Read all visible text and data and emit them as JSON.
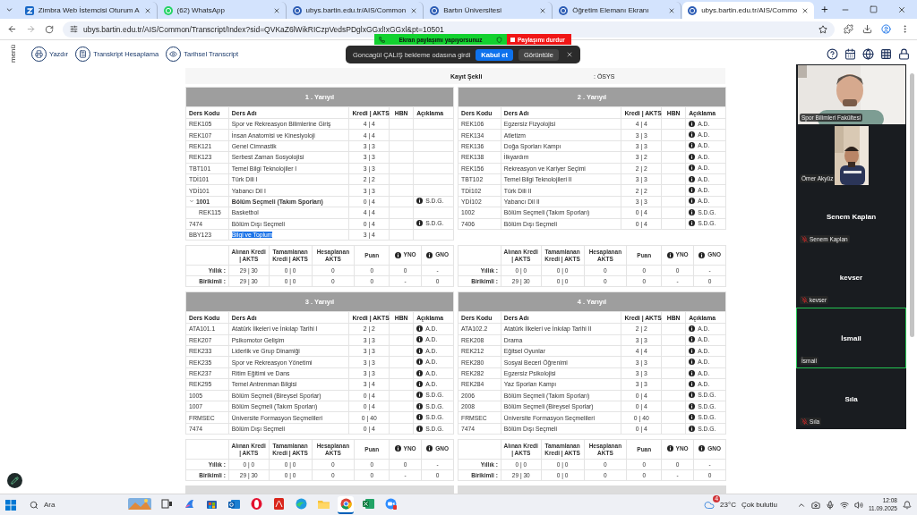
{
  "browser": {
    "tabs": [
      {
        "title": "Zimbra Web İstemcisi Oturum A",
        "kind": "zimbra",
        "selected": false
      },
      {
        "title": "(62) WhatsApp",
        "kind": "whatsapp",
        "selected": false
      },
      {
        "title": "ubys.bartin.edu.tr/AIS/Common",
        "kind": "site",
        "selected": false
      },
      {
        "title": "Bartın Üniversitesi",
        "kind": "site",
        "selected": false
      },
      {
        "title": "Öğretim Elemanı Ekranı",
        "kind": "site",
        "selected": false
      },
      {
        "title": "ubys.bartin.edu.tr/AIS/Commo",
        "kind": "site",
        "selected": true
      }
    ],
    "url": "ubys.bartin.edu.tr/AIS/Common/Transcript/Index?sid=QVKaZ6lWikRICzpVedsPDglxGGxl!xGGxl&pt=10501"
  },
  "toolbar": {
    "menu_label": "menü",
    "buttons": [
      {
        "kind": "print",
        "label": "Yazdır"
      },
      {
        "kind": "calculator",
        "label": "Transkript Hesaplama"
      },
      {
        "kind": "eye",
        "label": "Tarihsel Transcript"
      }
    ],
    "icons": [
      {
        "kind": "help"
      },
      {
        "kind": "calendar"
      },
      {
        "kind": "globe"
      },
      {
        "kind": "apps"
      },
      {
        "kind": "lock"
      }
    ]
  },
  "student_info": {
    "label": "Kayıt Şekli",
    "value": ": ÖSYS"
  },
  "semesters": [
    {
      "title": "1 . Yarıyıl",
      "columns": [
        "Ders Kodu",
        "Ders Adı",
        "Kredi | AKTS",
        "HBN",
        "Açıklama"
      ],
      "courses": [
        {
          "code": "REK105",
          "name": "Spor ve Rekreasyon Bilimlerine Giriş",
          "credits": "4 | 4"
        },
        {
          "code": "REK107",
          "name": "İnsan Anatomisi ve Kinesiyoloji",
          "credits": "4 | 4"
        },
        {
          "code": "REK121",
          "name": "Genel Cimnastik",
          "credits": "3 | 3"
        },
        {
          "code": "REK123",
          "name": "Serbest Zaman Sosyolojisi",
          "credits": "3 | 3"
        },
        {
          "code": "TBT101",
          "name": "Temel Bilgi Teknolojiler I",
          "credits": "3 | 3"
        },
        {
          "code": "TDİ101",
          "name": "Türk Dili I",
          "credits": "2 | 2"
        },
        {
          "code": "YDİ101",
          "name": "Yabancı Dil I",
          "credits": "3 | 3"
        },
        {
          "code": "1001",
          "name": "Bölüm Seçmeli (Takım Sporları)",
          "credits": "0 | 4",
          "note": "S.D.G.",
          "expanded": true,
          "children": [
            {
              "code": "REK115",
              "name": "Basketbol",
              "credits": "4 | 4"
            }
          ]
        },
        {
          "code": "7474",
          "name": "Bölüm Dışı Seçmeli",
          "credits": "0 | 4",
          "note": "S.D.G."
        },
        {
          "code": "BBY123",
          "name": "Bilgi ve Toplum",
          "credits": "3 | 4",
          "highlighted": true
        }
      ],
      "summary": {
        "columns": [
          {
            "label": "Alınan Kredi | AKTS",
            "info": false
          },
          {
            "label": "Tamamlanan Kredi | AKTS",
            "info": false
          },
          {
            "label": "Hesaplanan AKTS",
            "info": false
          },
          {
            "label": "Puan",
            "info": false
          },
          {
            "label": "YNO",
            "info": true
          },
          {
            "label": "GNO",
            "info": true
          }
        ],
        "rows": [
          {
            "label": "Yıllık :",
            "values": [
              "29 | 30",
              "0 | 0",
              "0",
              "0",
              "0",
              "-"
            ]
          },
          {
            "label": "Birikimli :",
            "values": [
              "29 | 30",
              "0 | 0",
              "0",
              "0",
              "-",
              "0"
            ]
          }
        ]
      }
    },
    {
      "title": "2 . Yarıyıl",
      "columns": [
        "Ders Kodu",
        "Ders Adı",
        "Kredi | AKTS",
        "HBN",
        "Açıklama"
      ],
      "courses": [
        {
          "code": "REK106",
          "name": "Egzersiz Fizyolojisi",
          "credits": "4 | 4",
          "note": "A.D."
        },
        {
          "code": "REK134",
          "name": "Atletizm",
          "credits": "3 | 3",
          "note": "A.D."
        },
        {
          "code": "REK136",
          "name": "Doğa Sporları Kampı",
          "credits": "3 | 3",
          "note": "A.D."
        },
        {
          "code": "REK138",
          "name": "İlkyardım",
          "credits": "3 | 2",
          "note": "A.D."
        },
        {
          "code": "REK156",
          "name": "Rekreasyon ve Kariyer Seçimi",
          "credits": "2 | 2",
          "note": "A.D."
        },
        {
          "code": "TBT102",
          "name": "Temel Bilgi Teknolojileri II",
          "credits": "3 | 3",
          "note": "A.D."
        },
        {
          "code": "TDİ102",
          "name": "Türk Dili II",
          "credits": "2 | 2",
          "note": "A.D."
        },
        {
          "code": "YDİ102",
          "name": "Yabancı Dil II",
          "credits": "3 | 3",
          "note": "A.D."
        },
        {
          "code": "1002",
          "name": "Bölüm Seçmeli (Takım Sporları)",
          "credits": "0 | 4",
          "note": "S.D.G."
        },
        {
          "code": "7406",
          "name": "Bölüm Dışı Seçmeli",
          "credits": "0 | 4",
          "note": "S.D.G."
        }
      ],
      "summary": {
        "columns": [
          {
            "label": "Alınan Kredi | AKTS",
            "info": false
          },
          {
            "label": "Tamamlanan Kredi | AKTS",
            "info": false
          },
          {
            "label": "Hesaplanan AKTS",
            "info": false
          },
          {
            "label": "Puan",
            "info": false
          },
          {
            "label": "YNO",
            "info": true
          },
          {
            "label": "GNO",
            "info": true
          }
        ],
        "rows": [
          {
            "label": "Yıllık :",
            "values": [
              "0 | 0",
              "0 | 0",
              "0",
              "0",
              "0",
              "-"
            ]
          },
          {
            "label": "Birikimli :",
            "values": [
              "29 | 30",
              "0 | 0",
              "0",
              "0",
              "-",
              "0"
            ]
          }
        ]
      }
    },
    {
      "title": "3 . Yarıyıl",
      "columns": [
        "Ders Kodu",
        "Ders Adı",
        "Kredi | AKTS",
        "HBN",
        "Açıklama"
      ],
      "courses": [
        {
          "code": "ATA101.1",
          "name": "Atatürk İlkeleri ve İnkılap Tarihi I",
          "credits": "2 | 2",
          "note": "A.D."
        },
        {
          "code": "REK207",
          "name": "Psikomotor Gelişim",
          "credits": "3 | 3",
          "note": "A.D."
        },
        {
          "code": "REK233",
          "name": "Liderlik ve Grup Dinamiği",
          "credits": "3 | 3",
          "note": "A.D."
        },
        {
          "code": "REK235",
          "name": "Spor ve Rekreasyon Yönetimi",
          "credits": "3 | 3",
          "note": "A.D."
        },
        {
          "code": "REK237",
          "name": "Ritim Eğitimi ve Dans",
          "credits": "3 | 3",
          "note": "A.D."
        },
        {
          "code": "REK295",
          "name": "Temel Antrenman Bilgisi",
          "credits": "3 | 4",
          "note": "A.D."
        },
        {
          "code": "1005",
          "name": "Bölüm Seçmeli (Bireysel Sporlar)",
          "credits": "0 | 4",
          "note": "S.D.G."
        },
        {
          "code": "1007",
          "name": "Bölüm Seçmeli (Takım Sporları)",
          "credits": "0 | 4",
          "note": "S.D.G."
        },
        {
          "code": "FRMSEC",
          "name": "Üniversite Formasyon Seçmelileri",
          "credits": "0 | 40",
          "note": "S.D.G."
        },
        {
          "code": "7474",
          "name": "Bölüm Dışı Seçmeli",
          "credits": "0 | 4",
          "note": "S.D.G."
        }
      ],
      "summary": {
        "columns": [
          {
            "label": "Alınan Kredi | AKTS",
            "info": false
          },
          {
            "label": "Tamamlanan Kredi | AKTS",
            "info": false
          },
          {
            "label": "Hesaplanan AKTS",
            "info": false
          },
          {
            "label": "Puan",
            "info": false
          },
          {
            "label": "YNO",
            "info": true
          },
          {
            "label": "GNO",
            "info": true
          }
        ],
        "rows": [
          {
            "label": "Yıllık :",
            "values": [
              "0 | 0",
              "0 | 0",
              "0",
              "0",
              "0",
              "-"
            ]
          },
          {
            "label": "Birikimli :",
            "values": [
              "29 | 30",
              "0 | 0",
              "0",
              "0",
              "-",
              "0"
            ]
          }
        ]
      }
    },
    {
      "title": "4 . Yarıyıl",
      "columns": [
        "Ders Kodu",
        "Ders Adı",
        "Kredi | AKTS",
        "HBN",
        "Açıklama"
      ],
      "courses": [
        {
          "code": "ATA102.2",
          "name": "Atatürk İlkeleri ve İnkılap Tarihi II",
          "credits": "2 | 2",
          "note": "A.D."
        },
        {
          "code": "REK208",
          "name": "Drama",
          "credits": "3 | 3",
          "note": "A.D."
        },
        {
          "code": "REK212",
          "name": "Eğitsel Oyunlar",
          "credits": "4 | 4",
          "note": "A.D."
        },
        {
          "code": "REK280",
          "name": "Sosyal Beceri Öğrenimi",
          "credits": "3 | 3",
          "note": "A.D."
        },
        {
          "code": "REK282",
          "name": "Egzersiz Psikolojisi",
          "credits": "3 | 3",
          "note": "A.D."
        },
        {
          "code": "REK284",
          "name": "Yaz Sporları Kampı",
          "credits": "3 | 3",
          "note": "A.D."
        },
        {
          "code": "2006",
          "name": "Bölüm Seçmeli (Takım Sporları)",
          "credits": "0 | 4",
          "note": "S.D.G."
        },
        {
          "code": "2008",
          "name": "Bölüm Seçmeli (Bireysel Sporlar)",
          "credits": "0 | 4",
          "note": "S.D.G."
        },
        {
          "code": "FRMSEC",
          "name": "Üniversite Formasyon Seçmelileri",
          "credits": "0 | 40",
          "note": "S.D.G."
        },
        {
          "code": "7474",
          "name": "Bölüm Dışı Seçmeli",
          "credits": "0 | 4",
          "note": "S.D.G."
        }
      ],
      "summary": {
        "columns": [
          {
            "label": "Alınan Kredi | AKTS",
            "info": false
          },
          {
            "label": "Tamamlanan Kredi | AKTS",
            "info": false
          },
          {
            "label": "Hesaplanan AKTS",
            "info": false
          },
          {
            "label": "Puan",
            "info": false
          },
          {
            "label": "YNO",
            "info": true
          },
          {
            "label": "GNO",
            "info": true
          }
        ],
        "rows": [
          {
            "label": "Yıllık :",
            "values": [
              "0 | 0",
              "0 | 0",
              "0",
              "0",
              "0",
              "-"
            ]
          },
          {
            "label": "Birikimli :",
            "values": [
              "29 | 30",
              "0 | 0",
              "0",
              "0",
              "-",
              "0"
            ]
          }
        ]
      }
    }
  ],
  "screen_share": {
    "status": "Ekran paylaşımı yapıyorsunuz",
    "stop": "Paylaşımı durdur"
  },
  "notification": {
    "message": "Goncagül ÇALIŞ bekleme odasına girdi",
    "accept": "Kabul et",
    "view": "Görüntüle"
  },
  "participants": [
    {
      "kind": "video",
      "label": "Spor Bilimleri Fakültesi",
      "muted": false,
      "speaking": false
    },
    {
      "kind": "video_narrow",
      "label": "Ömer Akyüz",
      "muted": false,
      "speaking": false
    },
    {
      "kind": "avatar",
      "name": "Senem Kaplan",
      "label": "Senem Kaplan",
      "muted": true,
      "speaking": false
    },
    {
      "kind": "avatar",
      "name": "kevser",
      "label": "kevser",
      "muted": true,
      "speaking": false
    },
    {
      "kind": "avatar",
      "name": "İsmail",
      "label": "İsmail",
      "muted": false,
      "speaking": true
    },
    {
      "kind": "avatar",
      "name": "Sıla",
      "label": "Sıla",
      "muted": true,
      "speaking": false
    }
  ],
  "taskbar": {
    "search_placeholder": "Ara",
    "apps": [
      {
        "kind": "widget",
        "selected": false
      },
      {
        "kind": "taskview",
        "selected": false
      },
      {
        "kind": "copilot",
        "selected": false
      },
      {
        "kind": "store",
        "selected": false
      },
      {
        "kind": "outlook",
        "selected": false
      },
      {
        "kind": "opera",
        "selected": false
      },
      {
        "kind": "acrobat",
        "selected": false
      },
      {
        "kind": "edge",
        "selected": false
      },
      {
        "kind": "explorer",
        "selected": false
      },
      {
        "kind": "chrome",
        "selected": true
      },
      {
        "kind": "excel",
        "selected": false
      },
      {
        "kind": "zoom",
        "selected": false
      }
    ],
    "weather_badge": "4",
    "temperature": "23°C",
    "weather": "Çok bulutlu",
    "time": "12:08",
    "date": "11.09.2025"
  }
}
